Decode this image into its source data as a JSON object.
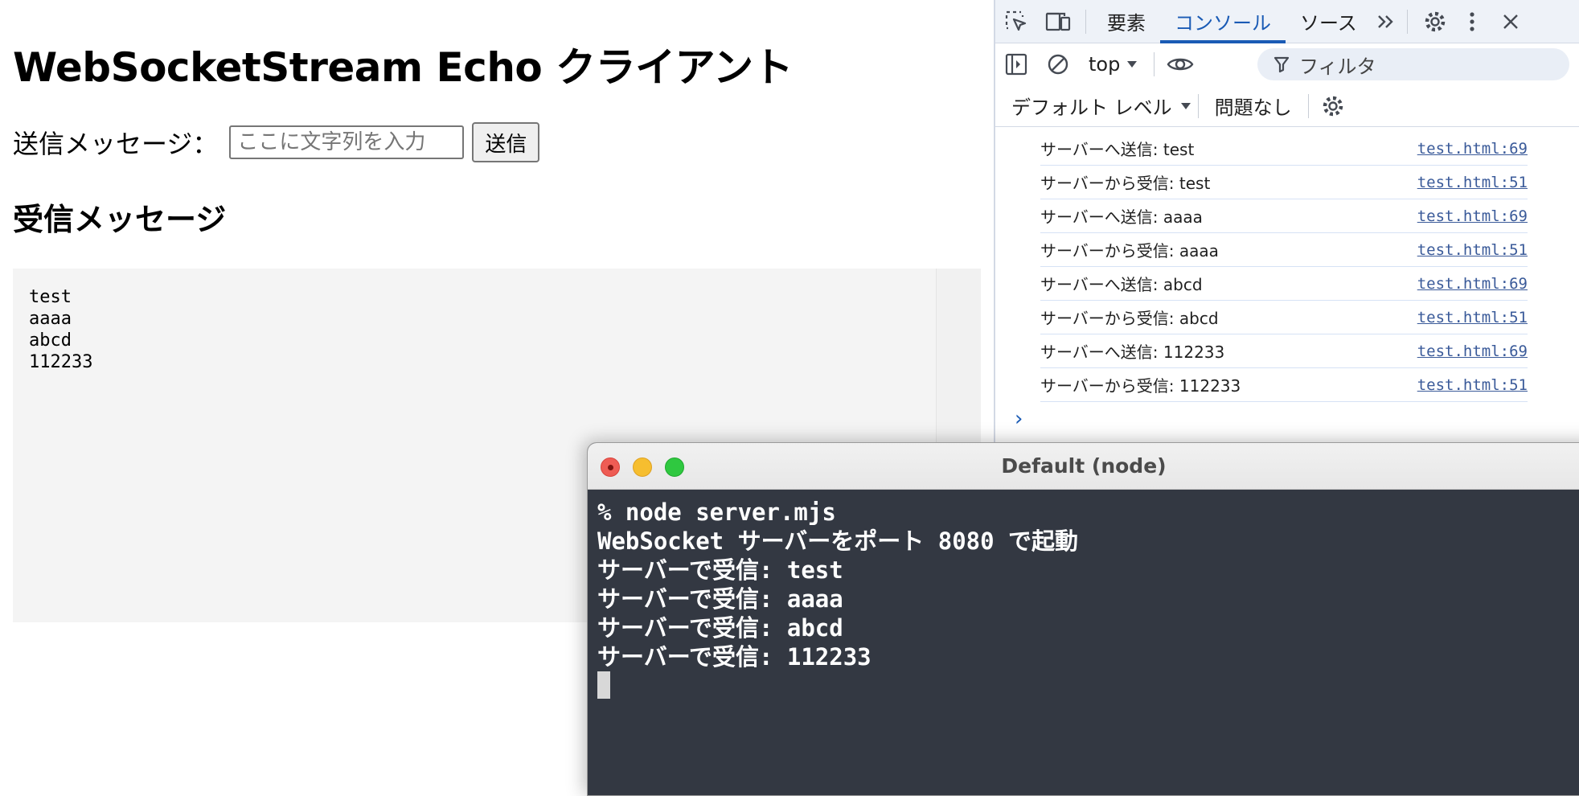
{
  "page": {
    "title": "WebSocketStream Echo クライアント",
    "send_label": "送信メッセージ：",
    "input_placeholder": "ここに文字列を入力",
    "send_button": "送信",
    "received_heading": "受信メッセージ",
    "received_lines": [
      "test",
      "aaaa",
      "abcd",
      "112233"
    ]
  },
  "devtools": {
    "tabs": [
      "要素",
      "コンソール",
      "ソース"
    ],
    "active_tab": "コンソール",
    "context": "top",
    "filter_placeholder": "フィルタ",
    "level": "デフォルト レベル",
    "issues": "問題なし",
    "accent_color": "#1a5bb5",
    "console_rows": [
      {
        "message": "サーバーへ送信: test",
        "source": "test.html:69"
      },
      {
        "message": "サーバーから受信: test",
        "source": "test.html:51"
      },
      {
        "message": "サーバーへ送信: aaaa",
        "source": "test.html:69"
      },
      {
        "message": "サーバーから受信: aaaa",
        "source": "test.html:51"
      },
      {
        "message": "サーバーへ送信: abcd",
        "source": "test.html:69"
      },
      {
        "message": "サーバーから受信: abcd",
        "source": "test.html:51"
      },
      {
        "message": "サーバーへ送信: 112233",
        "source": "test.html:69"
      },
      {
        "message": "サーバーから受信: 112233",
        "source": "test.html:51"
      }
    ],
    "prompt_glyph": "›"
  },
  "terminal": {
    "title": "Default (node)",
    "lines": [
      "% node server.mjs",
      "WebSocket サーバーをポート 8080 で起動",
      "サーバーで受信: test",
      "サーバーで受信: aaaa",
      "サーバーで受信: abcd",
      "サーバーで受信: 112233"
    ],
    "background_color": "#333842"
  }
}
